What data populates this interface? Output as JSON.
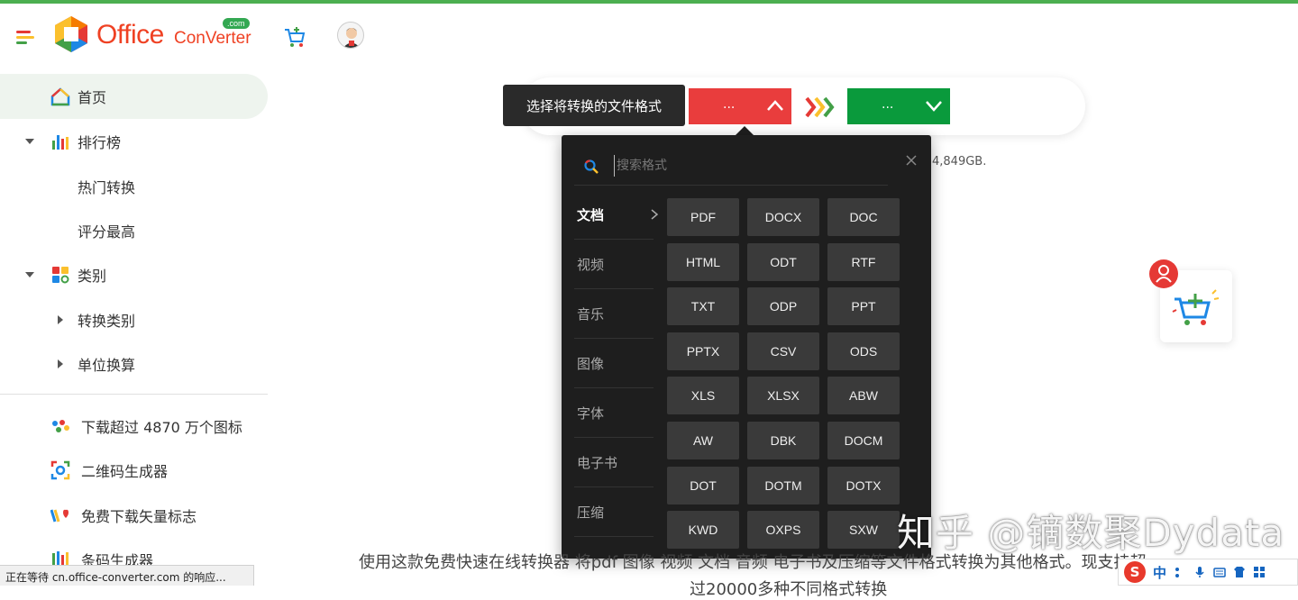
{
  "header": {
    "logo_text_main": "Office",
    "logo_text_sub": "ConVerter",
    "logo_badge": ".com"
  },
  "sidebar": {
    "items": [
      {
        "label": "首页",
        "icon": "home-icon",
        "active": true
      },
      {
        "label": "排行榜",
        "icon": "bar-chart-icon",
        "expanded": true
      },
      {
        "label": "热门转换"
      },
      {
        "label": "评分最高"
      },
      {
        "label": "类别",
        "icon": "grid-icon",
        "expanded": true
      },
      {
        "label": "转换类别",
        "collapsed": true
      },
      {
        "label": "单位换算",
        "collapsed": true
      }
    ],
    "tools": [
      {
        "label": "下载超过 4870 万个图标",
        "icon": "dots-icon"
      },
      {
        "label": "二维码生成器",
        "icon": "qr-scan-icon"
      },
      {
        "label": "免费下载矢量标志",
        "icon": "heart-logo-icon"
      },
      {
        "label": "条码生成器",
        "icon": "barcode-icon"
      }
    ]
  },
  "converter": {
    "tooltip": "选择将转换的文件格式",
    "from_value": "...",
    "to_value": "...",
    "size_note": "4,849GB."
  },
  "dropdown": {
    "search_placeholder": "搜索格式",
    "categories": [
      "文档",
      "视频",
      "音乐",
      "图像",
      "字体",
      "电子书",
      "压缩"
    ],
    "active_category": "文档",
    "formats": [
      "PDF",
      "DOCX",
      "DOC",
      "HTML",
      "ODT",
      "RTF",
      "TXT",
      "ODP",
      "PPT",
      "PPTX",
      "CSV",
      "ODS",
      "XLS",
      "XLSX",
      "ABW",
      "AW",
      "DBK",
      "DOCM",
      "DOT",
      "DOTM",
      "DOTX",
      "KWD",
      "OXPS",
      "SXW"
    ]
  },
  "description": {
    "line1": "使用这款免费快速在线转换器 将pdf 图像 视频 文档 音频 电子书及压缩等文件格式转换为其他格式。现支持超",
    "line2": "过20000多种不同格式转换"
  },
  "watermark": "知乎 @镝数聚Dydata",
  "status_bar": "正在等待 cn.office-converter.com 的响应...",
  "ime": {
    "label": "中"
  }
}
